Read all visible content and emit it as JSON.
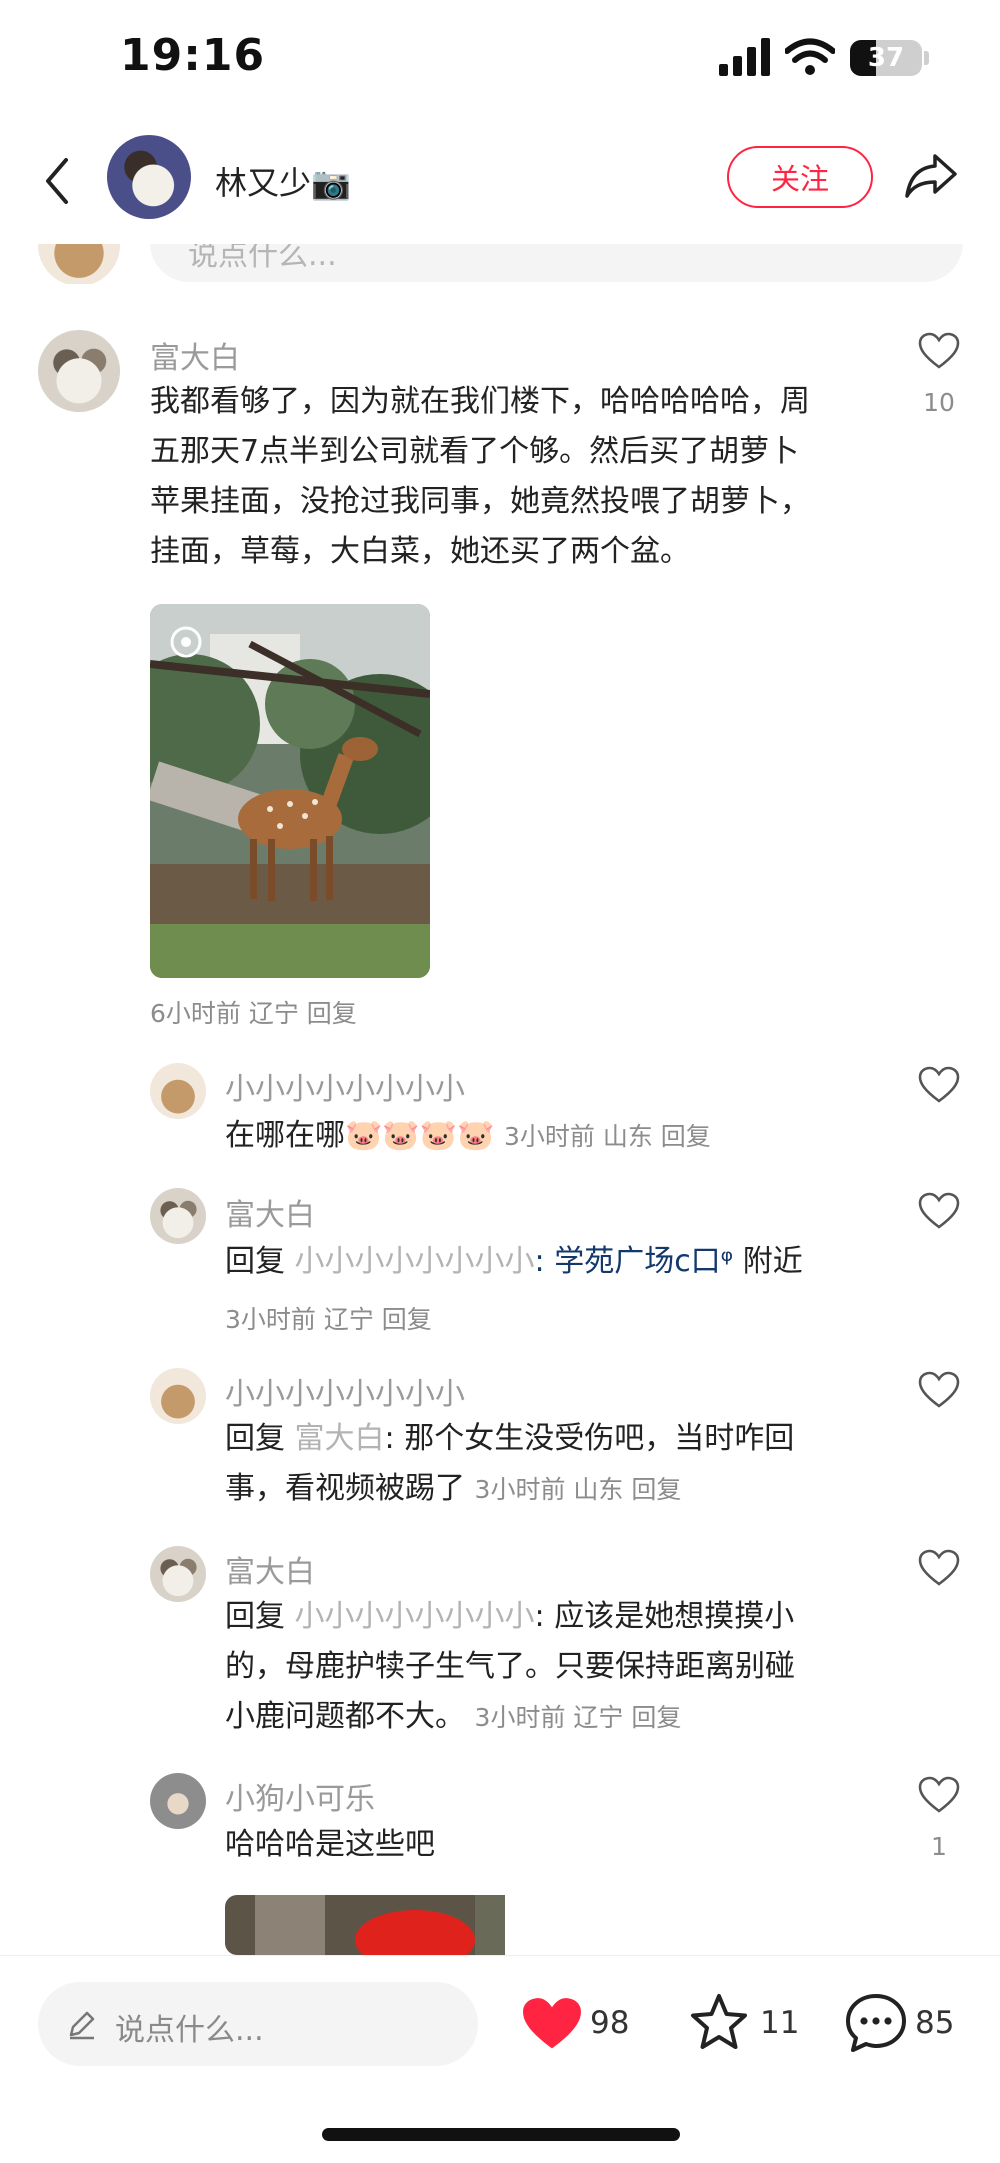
{
  "status_bar": {
    "time": "19:16",
    "battery": "37"
  },
  "header": {
    "username": "林又少📷",
    "follow_label": "关注"
  },
  "top_reply_input": {
    "placeholder": "说点什么..."
  },
  "comments": [
    {
      "user": "富大白",
      "text_lines": [
        "我都看够了，因为就在我们楼下，哈哈哈哈哈，周",
        "五那天7点半到公司就看了个够。然后买了胡萝卜",
        "苹果挂面，没抢过我同事，她竟然投喂了胡萝卜，",
        "挂面，草莓，大白菜，她还买了两个盆。"
      ],
      "meta": "6小时前 辽宁 回复",
      "likes": "10"
    }
  ],
  "replies": [
    {
      "user": "小小小小小小小小",
      "text": "在哪在哪🐷🐷🐷🐷",
      "meta": "3小时前 山东 回复"
    },
    {
      "user": "富大白",
      "reply_word": "回复",
      "mention": "小小小小小小小小",
      "link": ": 学苑广场c口ᵠ",
      "rest": " 附近",
      "meta": "3小时前 辽宁 回复"
    },
    {
      "user": "小小小小小小小小",
      "reply_word": "回复",
      "mention": "富大白",
      "line1": ": 那个女生没受伤吧，当时咋回",
      "line2": "事，看视频被踢了",
      "meta": "3小时前 山东 回复"
    },
    {
      "user": "富大白",
      "reply_word": "回复",
      "mention": "小小小小小小小小",
      "line1": ": 应该是她想摸摸小",
      "line2": "的，母鹿护犊子生气了。只要保持距离别碰",
      "line3": "小鹿问题都不大。",
      "meta": "3小时前 辽宁 回复"
    },
    {
      "user": "小狗小可乐",
      "text": "哈哈哈是这些吧",
      "likes": "1"
    }
  ],
  "bottom_bar": {
    "placeholder": "说点什么...",
    "likes": "98",
    "stars": "11",
    "comments": "85"
  },
  "colors": {
    "accent": "#ff2442",
    "link": "#13386c"
  },
  "icons": [
    "back-icon",
    "camera-icon",
    "share-icon",
    "heart-outline-icon",
    "heart-filled-icon",
    "star-icon",
    "comment-icon",
    "pencil-icon"
  ]
}
